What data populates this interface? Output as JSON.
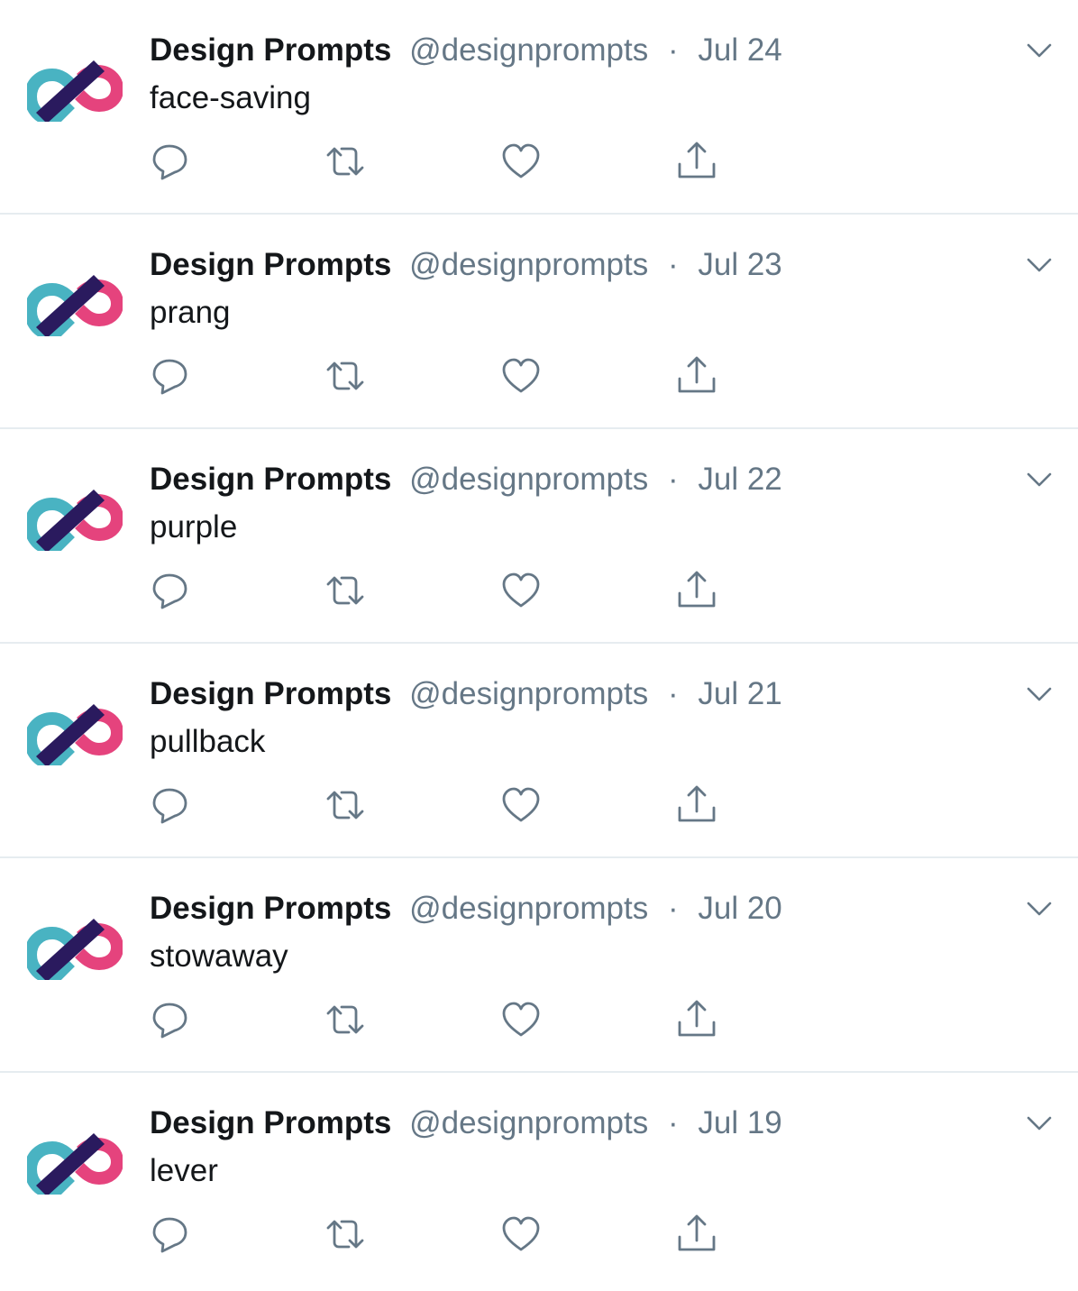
{
  "colors": {
    "name": "#14171a",
    "secondary": "#657786",
    "divider": "#e6ecf0",
    "logo_teal": "#49b3c2",
    "logo_pink": "#e5437d",
    "logo_purple": "#2a1a5e"
  },
  "tweets": [
    {
      "name": "Design Prompts",
      "handle": "@designprompts",
      "separator": "·",
      "date": "Jul 24",
      "text": "face-saving"
    },
    {
      "name": "Design Prompts",
      "handle": "@designprompts",
      "separator": "·",
      "date": "Jul 23",
      "text": "prang"
    },
    {
      "name": "Design Prompts",
      "handle": "@designprompts",
      "separator": "·",
      "date": "Jul 22",
      "text": "purple"
    },
    {
      "name": "Design Prompts",
      "handle": "@designprompts",
      "separator": "·",
      "date": "Jul 21",
      "text": "pullback"
    },
    {
      "name": "Design Prompts",
      "handle": "@designprompts",
      "separator": "·",
      "date": "Jul 20",
      "text": "stowaway"
    },
    {
      "name": "Design Prompts",
      "handle": "@designprompts",
      "separator": "·",
      "date": "Jul 19",
      "text": "lever"
    }
  ],
  "icons": {
    "avatar": "infinity-logo-icon",
    "reply": "reply-icon",
    "retweet": "retweet-icon",
    "like": "heart-icon",
    "share": "share-icon",
    "more": "chevron-down-icon"
  }
}
